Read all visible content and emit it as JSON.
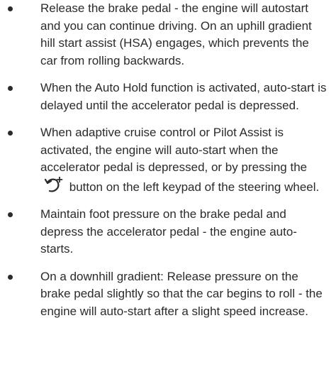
{
  "bullets": [
    {
      "text": "Release the brake pedal - the engine will autostart and you can continue driving. On an uphill gradient hill start assist (HSA) engages, which prevents the car from rolling backwards."
    },
    {
      "text": "When the Auto Hold function is activated, auto-start is delayed until the accelerator pedal is depressed."
    },
    {
      "text_before_icon": "When adaptive cruise control or Pilot Assist is activated, the engine will auto-start when the accelerator pedal is depressed, or by pressing the",
      "icon": "resume-plus-icon",
      "text_after_icon": "button on the left keypad of the steering wheel."
    },
    {
      "text": "Maintain foot pressure on the brake pedal and depress the accelerator pedal - the engine auto-starts."
    },
    {
      "text": "On a downhill gradient: Release pressure on the brake pedal slightly so that the car begins to roll - the engine will auto-start after a slight speed increase."
    }
  ]
}
